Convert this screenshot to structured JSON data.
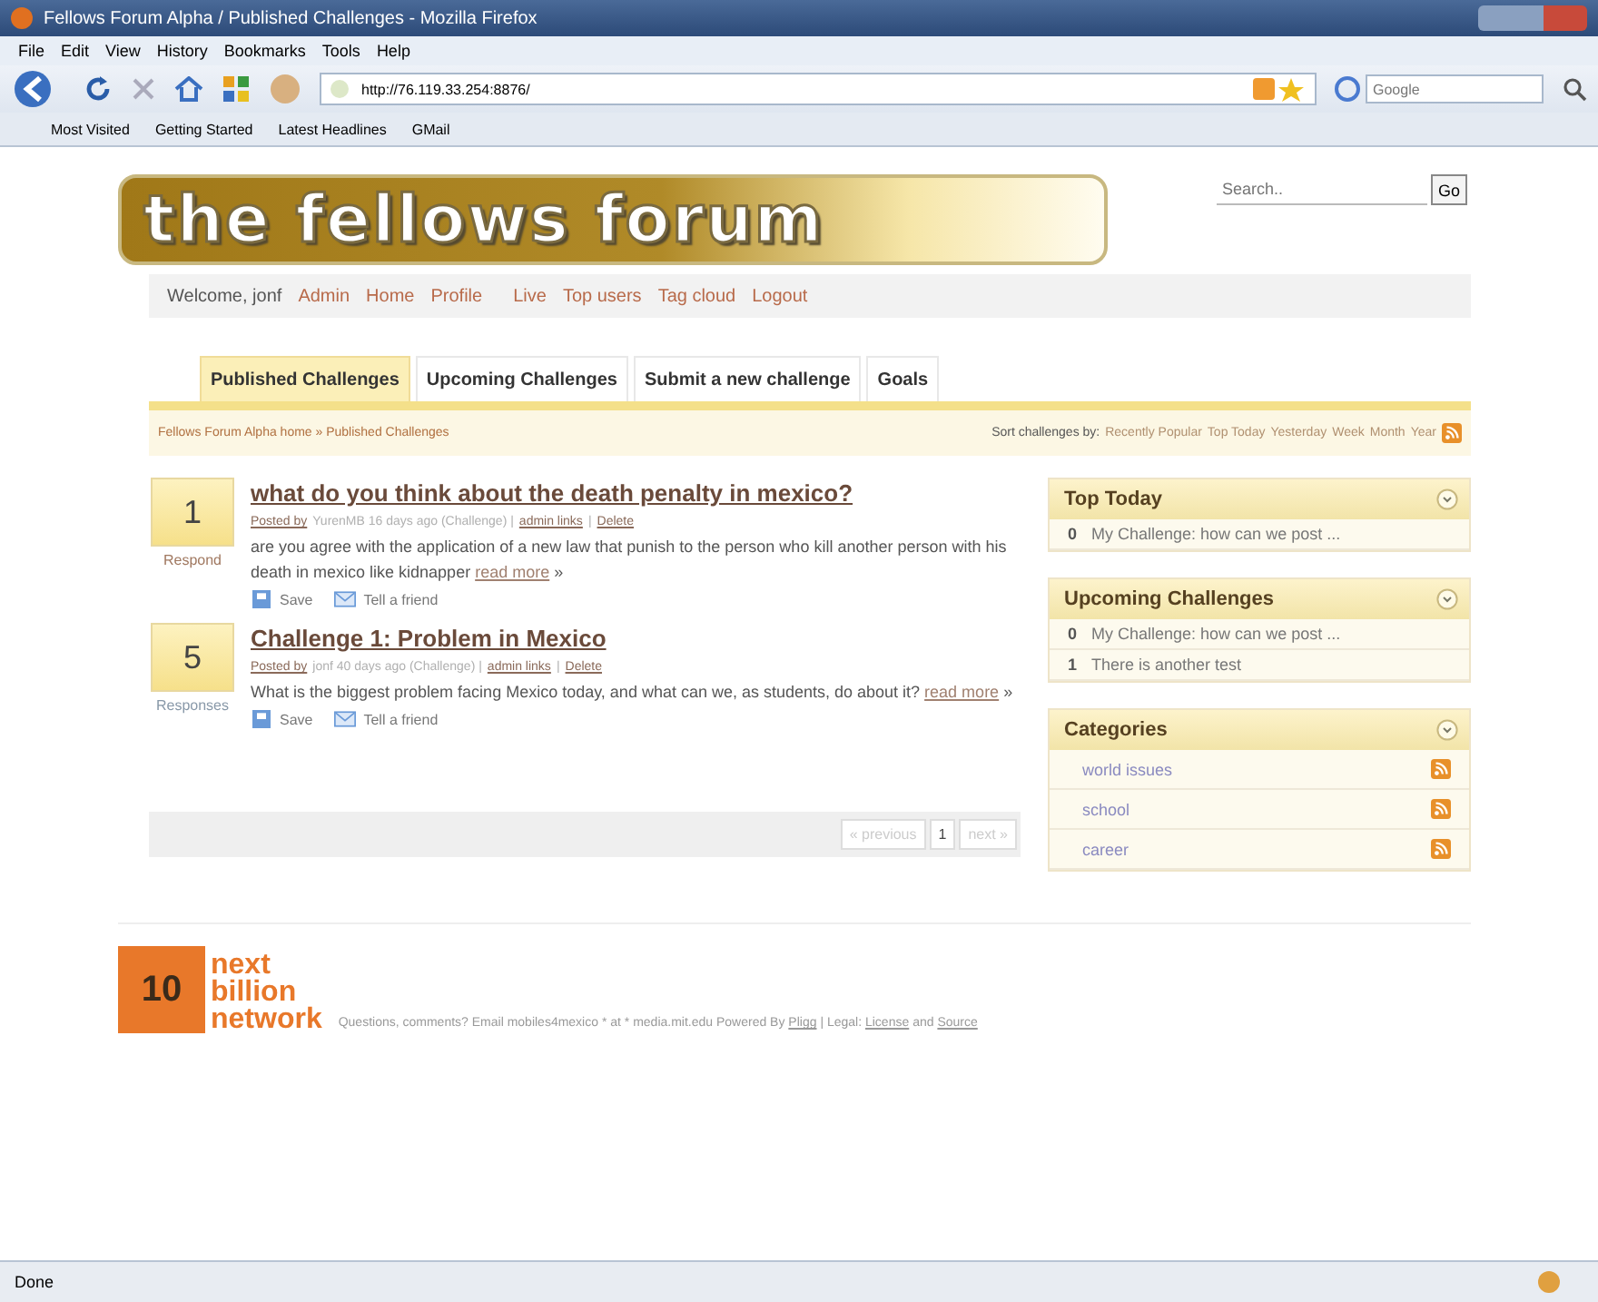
{
  "window": {
    "title": "Fellows Forum Alpha / Published Challenges - Mozilla Firefox"
  },
  "menu": [
    "File",
    "Edit",
    "View",
    "History",
    "Bookmarks",
    "Tools",
    "Help"
  ],
  "address": {
    "url": "http://76.119.33.254:8876/"
  },
  "web_search": {
    "placeholder": "Google"
  },
  "bookmarks": [
    "Most Visited",
    "Getting Started",
    "Latest Headlines",
    "GMail"
  ],
  "banner": {
    "title": "the fellows forum"
  },
  "site_search": {
    "placeholder": "Search..",
    "button": "Go"
  },
  "userbar": {
    "welcome": "Welcome, jonf",
    "links": [
      "Admin",
      "Home",
      "Profile",
      "Live",
      "Top users",
      "Tag cloud",
      "Logout"
    ]
  },
  "tabs": [
    {
      "label": "Published Challenges",
      "selected": true
    },
    {
      "label": "Upcoming Challenges",
      "selected": false
    },
    {
      "label": "Submit a new challenge",
      "selected": false
    },
    {
      "label": "Goals",
      "selected": false
    }
  ],
  "breadcrumb": "Fellows Forum Alpha home » Published Challenges",
  "sort": {
    "label": "Sort challenges by:",
    "options": [
      "Recently Popular",
      "Top Today",
      "Yesterday",
      "Week",
      "Month",
      "Year"
    ]
  },
  "posts": [
    {
      "votes": "1",
      "vote_label": "Respond",
      "vote_enabled": true,
      "title": "what do you think about the death penalty in mexico?",
      "posted_by": "Posted by",
      "meta": "YurenMB 16 days ago (Challenge) |",
      "admin": "admin links",
      "sep": "|",
      "delete": "Delete",
      "more_suffix": "»",
      "body": "are you agree with the application of a new law that punish to the person who kill another person with his death in mexico like kidnapper",
      "more": "read more",
      "save": "Save",
      "tell": "Tell a friend"
    },
    {
      "votes": "5",
      "vote_label": "Responses",
      "vote_enabled": false,
      "title": "Challenge 1: Problem in Mexico",
      "posted_by": "Posted by",
      "meta": "jonf 40 days ago (Challenge) |",
      "admin": "admin links",
      "sep": "|",
      "delete": "Delete",
      "more_suffix": "»",
      "body": "What is the biggest problem facing Mexico today, and what can we, as students, do about it?",
      "more": "read more",
      "save": "Save",
      "tell": "Tell a friend"
    }
  ],
  "pagination": [
    {
      "label": "« previous",
      "disabled": true
    },
    {
      "label": "1",
      "disabled": false
    },
    {
      "label": "next »",
      "disabled": true
    }
  ],
  "sidebar": [
    {
      "kind": "counts",
      "title": "Top Today",
      "items": [
        {
          "count": "0",
          "text": "My Challenge: how can we post ..."
        }
      ]
    },
    {
      "kind": "counts",
      "title": "Upcoming Challenges",
      "items": [
        {
          "count": "0",
          "text": "My Challenge: how can we post ..."
        },
        {
          "count": "1",
          "text": "There is another test"
        }
      ]
    },
    {
      "kind": "feeds",
      "title": "Categories",
      "items": [
        {
          "text": "world issues"
        },
        {
          "text": "school"
        },
        {
          "text": "career"
        }
      ]
    }
  ],
  "footer": {
    "logo_mark": "10",
    "logo_words": [
      "next",
      "billion",
      "network"
    ],
    "text": "Questions, comments? Email mobiles4mexico * at * media.mit.edu   Powered By",
    "pligg": "Pligg",
    "legal": "| Legal:",
    "license": "License",
    "and": "and",
    "source": "Source"
  },
  "status_bar": "Done"
}
